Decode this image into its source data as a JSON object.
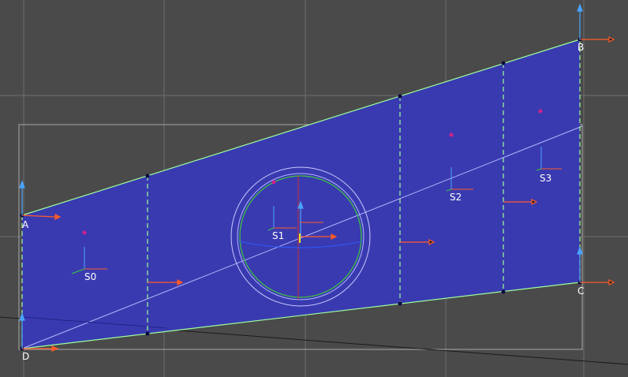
{
  "viewport": {
    "background": "#4a4a4a",
    "grid_color": "#6e6e6e",
    "panel_fill": "#3a3ab0",
    "edge_color": "#9cff9c",
    "arrow_color": "#ff5a28",
    "axis_up_color": "#4aa3ff",
    "marker_color": "#d0208e"
  },
  "corners": {
    "a": "A",
    "b": "B",
    "c": "C",
    "d": "D"
  },
  "segments": {
    "s0": "S0",
    "s1": "S1",
    "s2": "S2",
    "s3": "S3"
  }
}
